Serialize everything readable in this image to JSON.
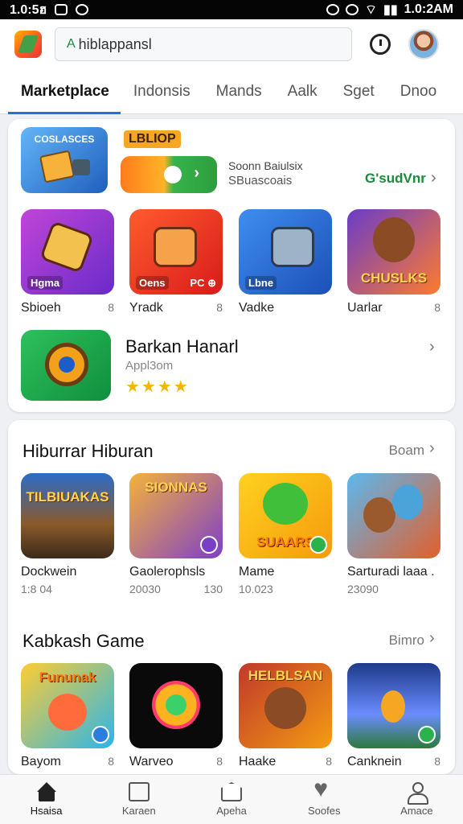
{
  "status": {
    "time_left": "1.0:5ฮ",
    "time_right": "1.0:2AM"
  },
  "appbar": {
    "search_value": "hiblappansl"
  },
  "tabs": [
    "Marketplace",
    "Indonsis",
    "Mands",
    "Aalk",
    "Sget",
    "Dnoo"
  ],
  "banner": {
    "image_caption": "COSLASCES",
    "title": "LBLIOP",
    "sub1": "Soonn Baiulsix",
    "sub2": "SBuascoais",
    "link": "G'sudVnr"
  },
  "top_apps": [
    {
      "name": "Sbioeh",
      "meta": "8",
      "tag": "Hgma",
      "tag2": ""
    },
    {
      "name": "Yradk",
      "meta": "8",
      "tag": "Oens",
      "tag2": "PC ⊕"
    },
    {
      "name": "Vadke",
      "meta": "",
      "tag": "Lbne",
      "tag2": ""
    },
    {
      "name": "Uarlar",
      "meta": "8",
      "tag": "",
      "tag2": "",
      "ribbon": "CHUSLKS"
    }
  ],
  "featured": {
    "title": "Barkan Hanarl",
    "sub": "Appl3om",
    "stars": "★★★★"
  },
  "section1": {
    "title": "Hiburrar Hiburan",
    "more": "Boam",
    "apps": [
      {
        "name": "Dockwein",
        "meta": "",
        "sub": "1:8 04",
        "sub2": "",
        "ribbon": "TILBIUAKAS"
      },
      {
        "name": "Gaolerophsls",
        "meta": "",
        "sub": "20030",
        "sub2": "130",
        "ribbon": "SIONNAS"
      },
      {
        "name": "Mame",
        "meta": "",
        "sub": "10.023",
        "sub2": "",
        "ribbon": "SUAARS"
      },
      {
        "name": "Sarturadi laaa .",
        "meta": "",
        "sub": "23090",
        "sub2": "",
        "ribbon": ""
      }
    ]
  },
  "section2": {
    "title": "Kabkash Game",
    "more": "Bimro",
    "apps": [
      {
        "name": "Bayom",
        "meta": "8",
        "ribbon": "Fununak"
      },
      {
        "name": "Warveo",
        "meta": "8",
        "ribbon": ""
      },
      {
        "name": "Haake",
        "meta": "8",
        "ribbon": "HELBLSAN"
      },
      {
        "name": "Canknein",
        "meta": "8",
        "ribbon": ""
      }
    ]
  },
  "nav": [
    "Hsaisa",
    "Karaen",
    "Apeha",
    "Soofes",
    "Amace"
  ]
}
